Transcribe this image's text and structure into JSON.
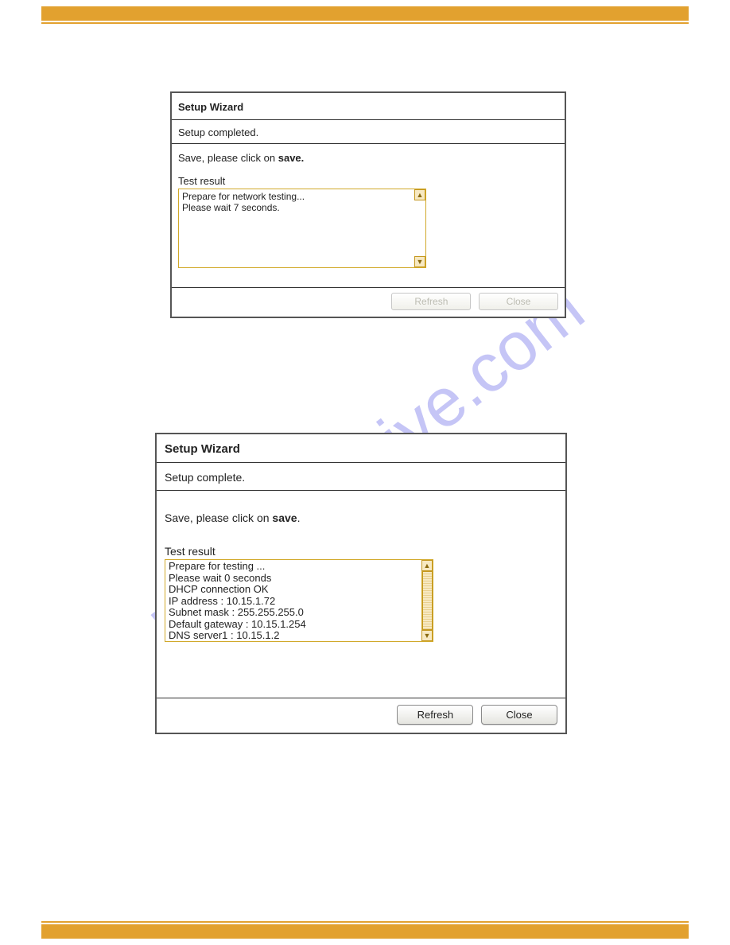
{
  "watermark": "manualshive.com",
  "dialog1": {
    "title": "Setup Wizard",
    "subtitle": "Setup completed.",
    "save_line_prefix": "Save, please click on ",
    "save_line_bold": "save.",
    "test_result_label": "Test result",
    "test_result_text": "Prepare for network testing...\nPlease wait  7  seconds.",
    "buttons": {
      "refresh": "Refresh",
      "close": "Close"
    }
  },
  "dialog2": {
    "title": "Setup Wizard",
    "subtitle": "Setup complete.",
    "save_line_prefix": "Save, please click on ",
    "save_line_bold": "save",
    "save_line_suffix": ".",
    "test_result_label": "Test result",
    "test_result_text": "Prepare for testing ...\nPlease wait 0 seconds\nDHCP connection OK\nIP address : 10.15.1.72\nSubnet mask : 255.255.255.0\nDefault gateway : 10.15.1.254\nDNS server1 : 10.15.1.2",
    "buttons": {
      "refresh": "Refresh",
      "close": "Close"
    }
  }
}
